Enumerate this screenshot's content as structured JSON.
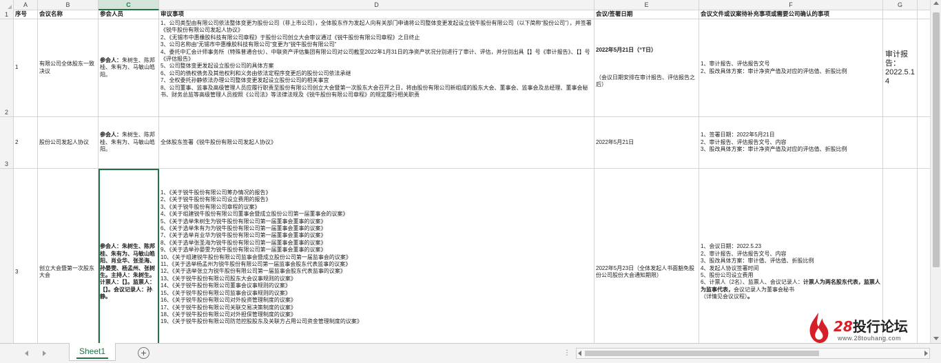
{
  "columns": [
    "A",
    "B",
    "C",
    "D",
    "E",
    "F",
    "G"
  ],
  "active_column": "C",
  "row_numbers": [
    "1",
    "2",
    "3",
    "3"
  ],
  "header": {
    "a": "序号",
    "b": "会议名称",
    "c": "参会人员",
    "d": "审议事项",
    "e": "会议/签署日期",
    "f": "会议文件或议案待补充事项或需要公司确认的事项",
    "g": ""
  },
  "rows": [
    {
      "a": "1",
      "b": "有限公司全体股东一致决议",
      "c_bold": "参会人：",
      "c_rest": "朱树生、陈邦桂、朱有为、马敏山皓阳。",
      "d": "1、公司类型由有限公司依法整体变更为股份公司（非上市公司），全体股东作为发起人向有关部门申请将公司整体变更发起设立锐牛股份有限公司（以下简称“股份公司”），并签署《锐牛股份有限公司发起人协议》\n2、《无锡市中惠橡胶科技有限公司章程》于股份公司创立大会审议通过《锐牛股份有限公司章程》之日终止\n3、公司名称由“无锡市中惠橡胶科技有限公司”变更为“锐牛股份有限公司”\n4、委托中汇会计师事务所（特殊普通合伙）、中联资产评估集团有限公司对公司截至2022年1月31日的净资产状况分别进行了审计、评估，并分别出具【】号《审计报告》、【】号《评估报告》\n5、公司整体变更发起设立股份公司的具体方案\n6、公司的债权债务及其他权利和义务由依法定程序变更后的股份公司依法承继\n7、全权委托孙静依法办理公司整体变更发起设立股份公司的相关事宜\n8、公司董事、监事及高级管理人员应履行职责至股份有限公司创立大会暨第一次股东大会召开之日，将由股份有限公司新组成的股东大会、董事会、监事会及总经理、董事会秘书、财务总监等高级管理人员按照《公司法》等法律法规及《锐牛股份有限公司章程》的规定履行相关职责",
      "e_main": "2022年5月21日（“T日）",
      "e_note": "（会议日期安排在审计报告、评估报告之后）",
      "f": "1、审计报告、评估报告文号\n2、股改具体方案：审计净资产值及对应的评估值、折股比例",
      "g": "审计报告：\n2022.5.14"
    },
    {
      "a": "2",
      "b": "股份公司发起人协议",
      "c_bold": "参会人：",
      "c_rest": "朱树生、陈邦桂、朱有为、马敏山皓阳。",
      "d": "全体股东签署《锐牛股份有限公司发起人协议》",
      "e_main": "2022年5月21日",
      "e_note": "",
      "f": "1、签署日期：2022年5月21日\n2、审计报告、评估报告文号、内容\n3、股改具体方案：审计净资产值及对应的评估值、折股比例",
      "g": ""
    },
    {
      "a": "3",
      "b": "创立大会暨第一次股东大会",
      "c_text": "参会人：朱树生、陈邦桂、朱有为、马敏山皓阳、肖业华、张圣海、孙晏雯、杨孟州、张树生。主持人：朱树生。计票人：【】。监票人：【】。会议记录人：孙静。",
      "d": "1、《关于锐牛股份有限公司筹办情况的报告》\n2、《关于锐牛股份有限公司设立费用的报告》\n3、《关于锐牛股份有限公司章程的议案》\n4、《关于组建锐牛股份有限公司董事会暨成立股份公司第一届董事会的议案》\n5、《关于选举朱树生为锐牛股份有限公司第一届董事会董事的议案》\n6、《关于选举朱有为为锐牛股份有限公司第一届董事会董事的议案》\n7、《关于选举肖业华为锐牛股份有限公司第一届董事会董事的议案》\n8、《关于选举张圣海为锐牛股份有限公司第一届董事会董事的议案》\n9、《关于选举孙晏雯为锐牛股份有限公司第一届董事会董事的议案》\n10、《关于组建锐牛股份有限公司监事会暨成立股份公司第一届监事会的议案》\n11、《关于选举杨孟州为锐牛股份有限公司第一届监事会股东代表监事的议案》\n12、《关于选举张立为锐牛股份有限公司第一届监事会股东代表监事的议案》\n13、《关于锐牛股份有限公司股东大会议事规则的议案》\n14、《关于锐牛股份有限公司董事会议事规则的议案》\n15、《关于锐牛股份有限公司监事会议事规则的议案》\n16、《关于锐牛股份有限公司对外投资管理制度的议案》\n17、《关于锐牛股份有限公司关联交易决策制度的议案》\n18、《关于锐牛股份有限公司对外担保管理制度的议案》\n19、《关于锐牛股份有限公司防范控股股东及关联方占用公司资金管理制度的议案》",
      "e_main": "2022年5月23日（全体发起人书面豁免股份公司股份大会通知期限）",
      "e_note": "",
      "f_plain": "1、会议日期：2022.5.23\n2、审计报告、评估报告文号、内容\n3、股改具体方案：审计值、评估值、折股比例\n4、发起人协议签署时间\n5、股份公司设立费用\n6、计票人（2名）、监票人、会议记录人：",
      "f_bold": "计票人为两名股东代表，监票人为监事代表，",
      "f_after": "会议记录人为董事会秘书\n（详情见会议议程）",
      "f_tail": "。",
      "g": ""
    }
  ],
  "sheet_tabs": [
    {
      "label": "Sheet1",
      "active": true
    }
  ],
  "add_sheet_label": "+",
  "hscroll_dots": "⋮",
  "watermark": {
    "brand_num": "28",
    "brand_text": "投行论坛",
    "url": "www.28touhang.com"
  }
}
